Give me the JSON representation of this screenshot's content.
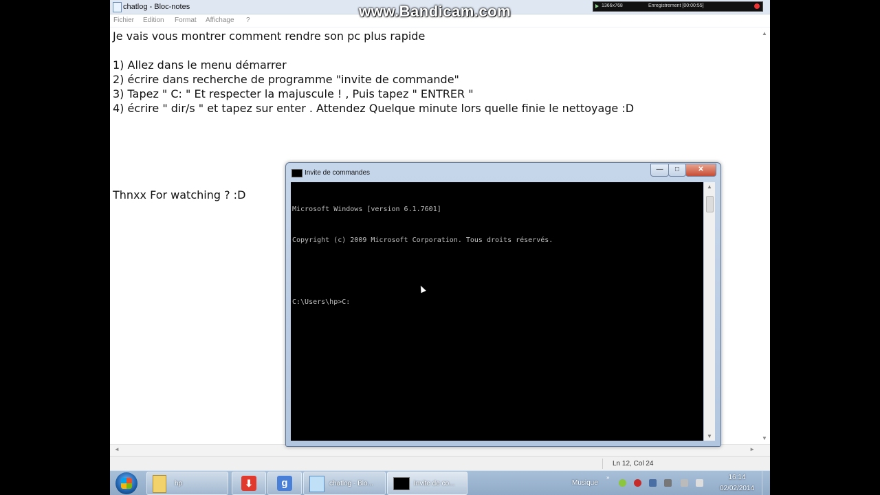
{
  "notepad": {
    "title": "chatlog - Bloc-notes",
    "menu": [
      "Fichier",
      "Edition",
      "Format",
      "Affichage",
      "?"
    ],
    "lines": [
      "Je vais vous montrer comment rendre son pc plus rapide",
      "1) Allez dans le menu démarrer",
      "2) écrire dans recherche de programme \"invite de commande\"",
      "3) Tapez \" C: \" Et respecter la majuscule ! , Puis tapez \" ENTRER \"",
      "4) écrire \" dir/s \" et tapez sur enter . Attendez Quelque minute lors quelle finie le nettoyage :D",
      "Thnxx For watching ? :D"
    ],
    "status": "Ln 12, Col 24"
  },
  "bandicam": {
    "watermark": "www.Bandicam.com",
    "resolution": "1366x768",
    "recording": "Enregistrement [00:00:55]"
  },
  "cmd": {
    "title": "Invite de commandes",
    "lines": [
      "Microsoft Windows [version 6.1.7601]",
      "Copyright (c) 2009 Microsoft Corporation. Tous droits réservés.",
      "",
      "C:\\Users\\hp>C:"
    ],
    "buttons": {
      "minimize": "—",
      "maximize": "□",
      "close": "✕"
    }
  },
  "taskbar": {
    "items": [
      {
        "label": "hp",
        "icon": "folder-icon"
      },
      {
        "label": "",
        "icon": "download-icon"
      },
      {
        "label": "",
        "icon": "google-icon"
      },
      {
        "label": "chatlog - Blo...",
        "icon": "notepad-icon"
      },
      {
        "label": "Invite de co...",
        "icon": "cmd-icon"
      }
    ],
    "tray": {
      "music": "Musique",
      "time": "16:14",
      "date": "02/02/2014"
    }
  }
}
